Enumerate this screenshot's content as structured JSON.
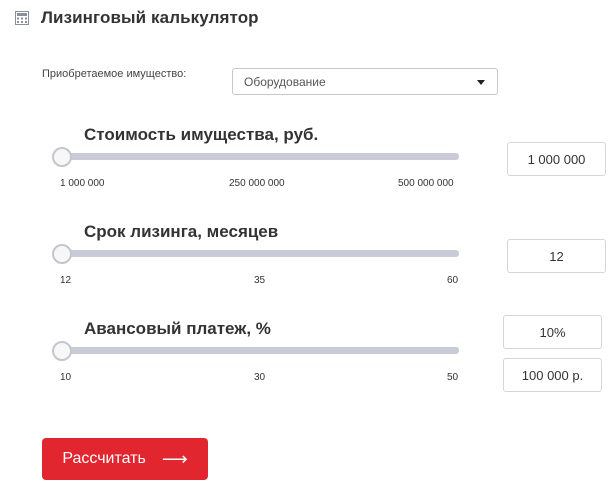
{
  "header": {
    "title": "Лизинговый калькулятор",
    "icon": "calculator-icon"
  },
  "property": {
    "label": "Приобретаемое имущество:",
    "selected": "Оборудование"
  },
  "sliders": [
    {
      "title": "Стоимость имущества, руб.",
      "ticks": [
        "1 000 000",
        "250 000 000",
        "500 000 000"
      ],
      "value": "1 000 000",
      "fraction": 0
    },
    {
      "title": "Срок лизинга, месяцев",
      "ticks": [
        "12",
        "35",
        "60"
      ],
      "value": "12",
      "fraction": 0
    },
    {
      "title": "Авансовый платеж, %",
      "ticks": [
        "10",
        "30",
        "50"
      ],
      "value": "10%",
      "value2": "100 000 р.",
      "fraction": 0
    }
  ],
  "button": {
    "label": "Рассчитать",
    "arrow": "⟶"
  },
  "colors": {
    "accent": "#e2262f",
    "track": "#c9ccd6",
    "text": "#333333"
  }
}
